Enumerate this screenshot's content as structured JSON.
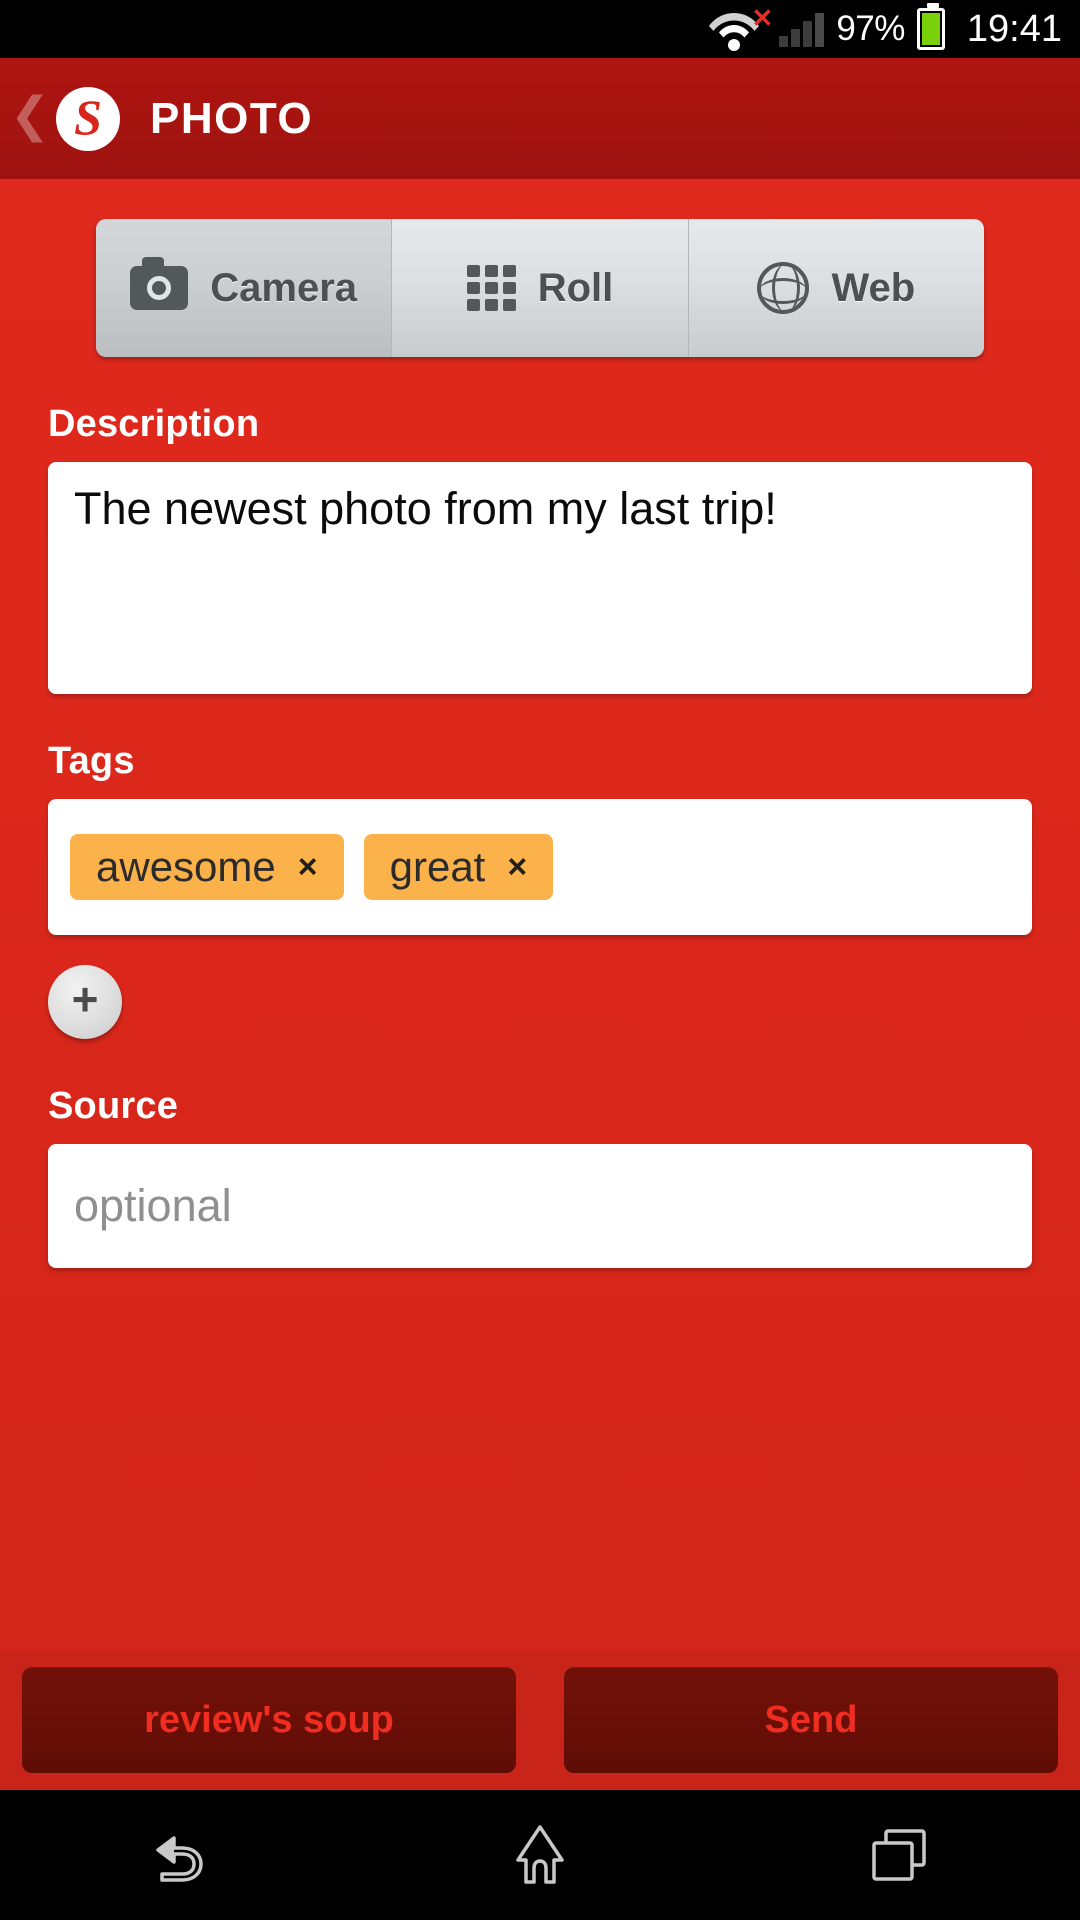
{
  "status_bar": {
    "wifi_icon": "wifi-icon",
    "wifi_error_icon": "wifi-error-x-icon",
    "signal_icon": "cellular-signal-icon",
    "battery_percent": "97%",
    "battery_icon": "battery-icon",
    "time": "19:41"
  },
  "header": {
    "back_icon": "back-chevron-icon",
    "logo_letter": "S",
    "logo_icon": "soup-logo-icon",
    "title": "PHOTO"
  },
  "source_tabs": {
    "selected": "Camera",
    "items": [
      {
        "label": "Camera",
        "icon": "camera-icon",
        "active": true
      },
      {
        "label": "Roll",
        "icon": "grid-icon",
        "active": false
      },
      {
        "label": "Web",
        "icon": "globe-icon",
        "active": false
      }
    ]
  },
  "description": {
    "label": "Description",
    "value": "The newest photo from my last trip!",
    "placeholder": ""
  },
  "tags": {
    "label": "Tags",
    "items": [
      {
        "name": "awesome",
        "remove_icon": "×"
      },
      {
        "name": "great",
        "remove_icon": "×"
      }
    ],
    "add_button_label": "+"
  },
  "source": {
    "label": "Source",
    "value": "",
    "placeholder": "optional"
  },
  "actions": {
    "target_label": "review's soup",
    "send_label": "Send"
  },
  "nav_bar": {
    "back_icon": "android-back-icon",
    "home_icon": "android-home-icon",
    "recents_icon": "android-recents-icon"
  },
  "colors": {
    "brand_red": "#d9261c",
    "header_red": "#a61410",
    "tag_orange": "#fcb24a",
    "action_maroon": "#6a0f07",
    "action_text_red": "#ef2d20",
    "battery_green": "#7ad10a",
    "wifi_error_red": "#ee2b20"
  }
}
